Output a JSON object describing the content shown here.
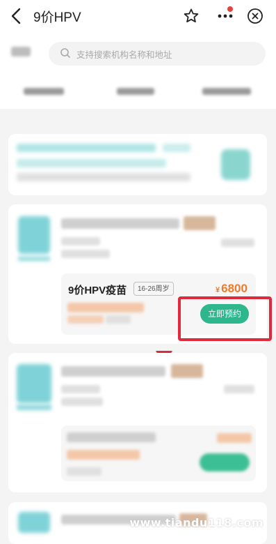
{
  "header": {
    "title": "9价HPV",
    "back_icon": "chevron-left-icon",
    "star_icon": "star-icon",
    "more_icon": "more-dots-icon",
    "close_icon": "close-circle-icon",
    "badge_color": "#e8403a"
  },
  "search": {
    "placeholder": "支持搜索机构名称和地址"
  },
  "listing": {
    "vaccine_name": "9价HPV疫苗",
    "age_tag": "16-26周岁",
    "currency": "¥",
    "price": "6800",
    "book_button": "立即预约",
    "accent_color": "#2eb78d",
    "price_color": "#f07a2a"
  },
  "annotation": {
    "box_color": "#e0293a"
  },
  "watermark": {
    "text": "www.tiandu118.com"
  }
}
